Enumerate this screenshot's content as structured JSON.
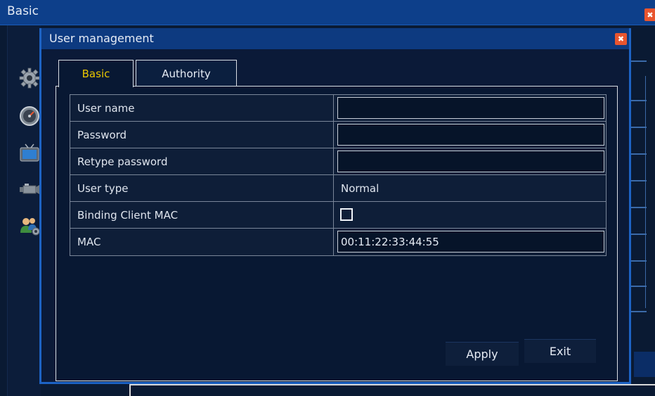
{
  "outer_window": {
    "title": "Basic",
    "close_glyph": "✖",
    "sidebar_icons": [
      "gear-icon",
      "speedometer-icon",
      "monitor-icon",
      "camera-icon",
      "users-settings-icon"
    ]
  },
  "dialog": {
    "title": "User management",
    "close_glyph": "✖",
    "tabs": [
      {
        "label": "Basic",
        "active": true
      },
      {
        "label": "Authority",
        "active": false
      }
    ],
    "form": {
      "user_name_label": "User name",
      "user_name_value": "",
      "password_label": "Password",
      "password_value": "",
      "retype_password_label": "Retype password",
      "retype_password_value": "",
      "user_type_label": "User type",
      "user_type_value": "Normal",
      "binding_mac_label": "Binding Client MAC",
      "binding_mac_checked": false,
      "mac_label": "MAC",
      "mac_value": "00:11:22:33:44:55"
    },
    "buttons": {
      "apply": "Apply",
      "exit": "Exit"
    }
  },
  "colors": {
    "titlebar": "#0d3a80",
    "accent_border": "#1d63c4",
    "active_tab_text": "#e9c600",
    "close_button": "#e8552f"
  }
}
